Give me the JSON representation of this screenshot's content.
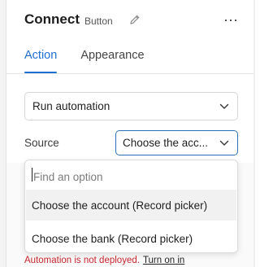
{
  "header": {
    "title": "Connect",
    "subtitle": "Button",
    "edit_icon": "pencil-icon",
    "more_icon": "more-horizontal-icon",
    "more_label": "···"
  },
  "tabs": [
    {
      "label": "Action",
      "active": true
    },
    {
      "label": "Appearance",
      "active": false
    }
  ],
  "action": {
    "value": "Run automation"
  },
  "source": {
    "label": "Source",
    "value": "Choose the account (Record picker)",
    "display_value": "Choose the acc..."
  },
  "dropdown": {
    "search_placeholder": "Find an option",
    "options": [
      {
        "label": "Choose the account (Record picker)",
        "highlighted": true
      },
      {
        "label": "Choose the bank (Record picker)",
        "highlighted": false
      }
    ]
  },
  "status": {
    "message": "Automation is not deployed.",
    "link": "Turn on in"
  },
  "colors": {
    "accent": "#1f6fd0",
    "error": "#c6262e",
    "focus_border": "#2d6fb5"
  }
}
